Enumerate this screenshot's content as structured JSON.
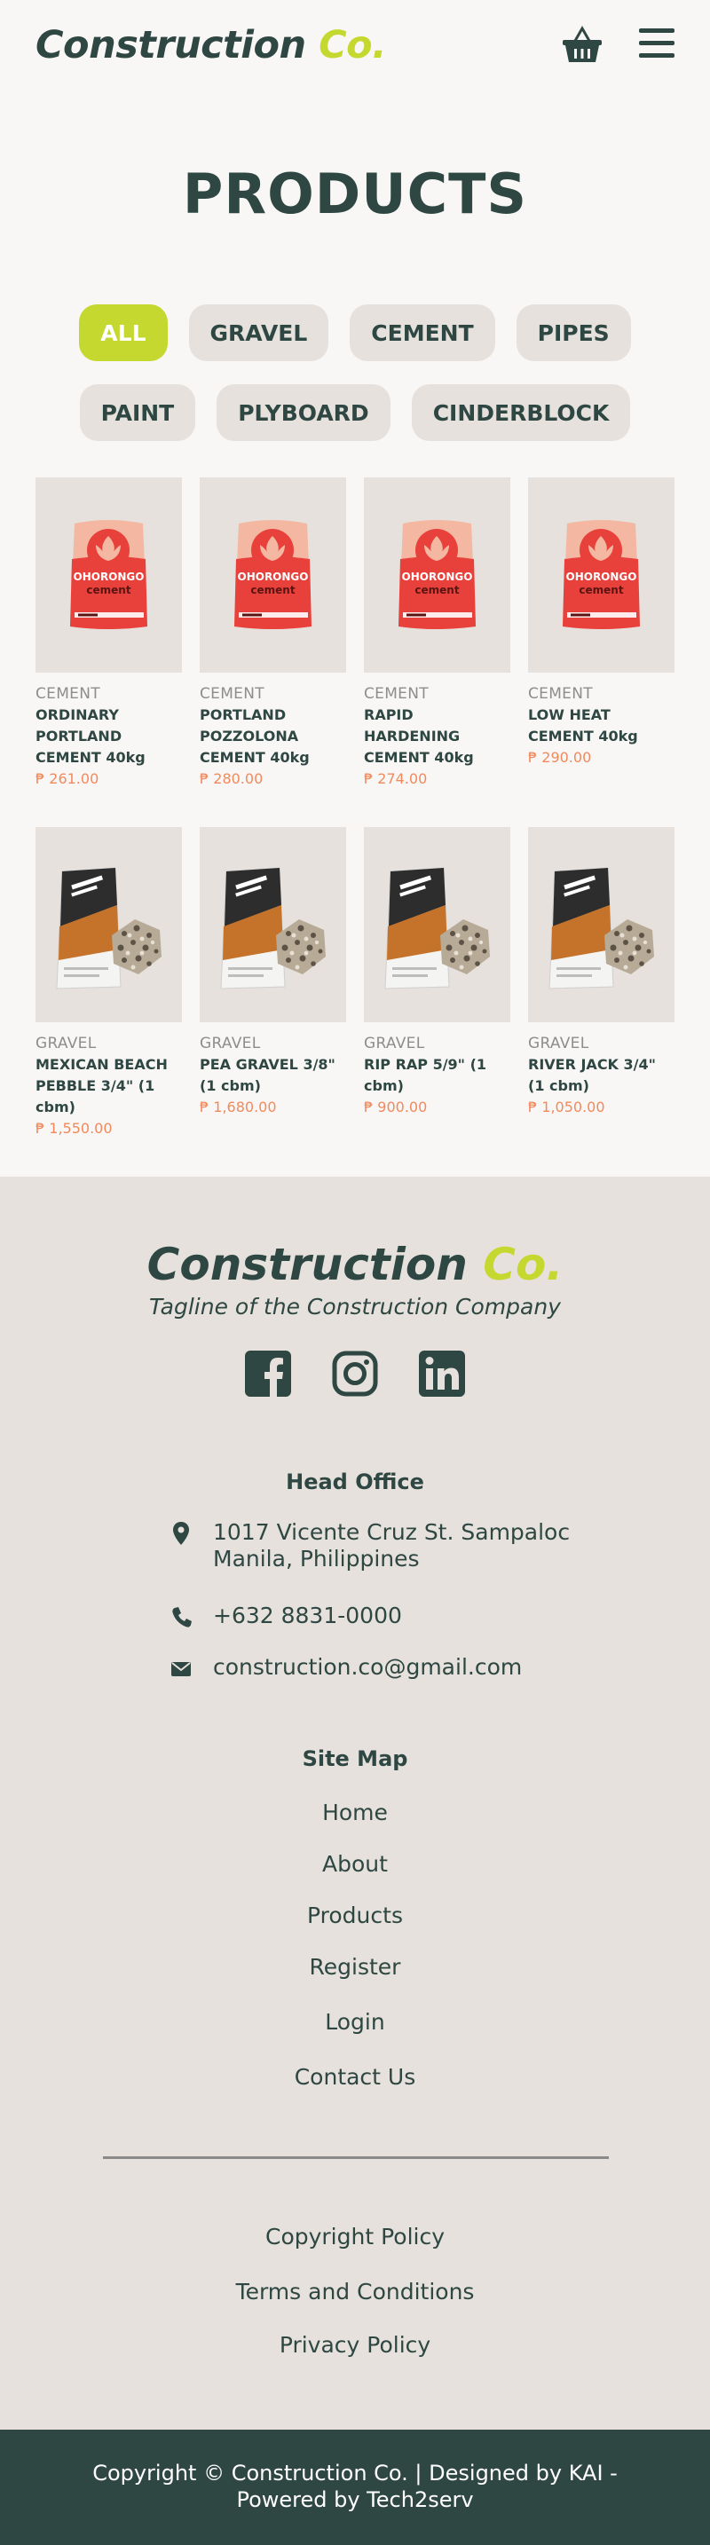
{
  "header": {
    "logo_main": "Construction",
    "logo_accent": "Co."
  },
  "page": {
    "title": "PRODUCTS"
  },
  "filters": [
    "ALL",
    "GRAVEL",
    "CEMENT",
    "PIPES",
    "PAINT",
    "PLYBOARD",
    "CINDERBLOCK"
  ],
  "products": [
    {
      "category": "CEMENT",
      "name": "ORDINARY PORTLAND CEMENT 40kg",
      "price": "₱ 261.00",
      "image": "cement-bag"
    },
    {
      "category": "CEMENT",
      "name": "PORTLAND POZZOLONA CEMENT 40kg",
      "price": "₱ 280.00",
      "image": "cement-bag"
    },
    {
      "category": "CEMENT",
      "name": "RAPID HARDENING CEMENT 40kg",
      "price": "₱ 274.00",
      "image": "cement-bag"
    },
    {
      "category": "CEMENT",
      "name": "LOW HEAT CEMENT 40kg",
      "price": "₱ 290.00",
      "image": "cement-bag"
    },
    {
      "category": "GRAVEL",
      "name": "MEXICAN BEACH PEBBLE 3/4\" (1 cbm)",
      "price": "₱ 1,550.00",
      "image": "gravel-bag"
    },
    {
      "category": "GRAVEL",
      "name": "PEA GRAVEL 3/8\" (1 cbm)",
      "price": "₱ 1,680.00",
      "image": "gravel-bag"
    },
    {
      "category": "GRAVEL",
      "name": "RIP RAP 5/9\" (1 cbm)",
      "price": "₱ 900.00",
      "image": "gravel-bag"
    },
    {
      "category": "GRAVEL",
      "name": "RIVER JACK 3/4\" (1 cbm)",
      "price": "₱ 1,050.00",
      "image": "gravel-bag"
    }
  ],
  "bag": {
    "brand": "OHORONGO",
    "type": "cement"
  },
  "footer": {
    "logo_main": "Construction",
    "logo_accent": "Co.",
    "tagline": "Tagline of the Construction Company",
    "social": [
      "facebook-icon",
      "instagram-icon",
      "linkedin-icon"
    ],
    "head_office_title": "Head Office",
    "address_line1": "1017 Vicente Cruz St. Sampaloc",
    "address_line2": "Manila, Philippines",
    "phone": "+632 8831-0000",
    "email": "construction.co@gmail.com",
    "sitemap_title": "Site Map",
    "sitemap": [
      "Home",
      "About",
      "Products",
      "Register",
      "Login",
      "Contact Us"
    ],
    "policies": [
      "Copyright Policy",
      "Terms and Conditions",
      "Privacy Policy"
    ],
    "copyright_line1": "Copyright © Construction Co.  | Designed by KAI -",
    "copyright_line2": "Powered by Tech2serv"
  },
  "colors": {
    "primary": "#2f4742",
    "accent": "#c4d82f",
    "price": "#f08a5d",
    "chip_bg": "#e6e1dc",
    "page_bg": "#f9f7f5"
  }
}
